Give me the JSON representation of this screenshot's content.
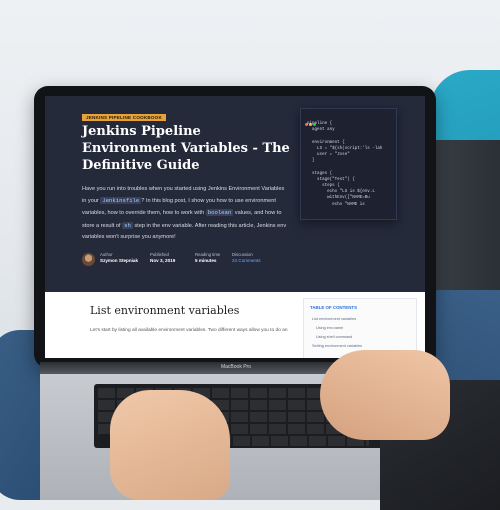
{
  "article": {
    "tag": "JENKINS PIPELINE COOKBOOK",
    "title": "Jenkins Pipeline Environment Variables - The Definitive Guide",
    "intro_parts": [
      "Have you run into troubles when you started using Jenkins Environment Variables in your ",
      "Jenkinsfile",
      "? In this blog post, I show you how to use environment variables, how to override them, how to work with ",
      "boolean",
      " values, and how to store a result of ",
      "sh",
      " step in the env variable. After reading this article, Jenkins env variables won't surprise you anymore!"
    ],
    "author_label": "Author",
    "author_name": "Szymon Stepniak",
    "published_label": "Published",
    "published_value": "Nov 3, 2019",
    "reading_label": "Reading time",
    "reading_value": "5 minutes",
    "discuss_label": "Discussion",
    "discuss_value": "24 Comments"
  },
  "code_snippet": [
    {
      "t": "pipeline {"
    },
    {
      "t": "  agent any"
    },
    {
      "t": ""
    },
    {
      "t": "  environment {"
    },
    {
      "t": "    LS = \"${sh(script:'ls -lah"
    },
    {
      "t": "    user = \"Jose\""
    },
    {
      "t": "  }"
    },
    {
      "t": ""
    },
    {
      "t": "  stages {"
    },
    {
      "t": "    stage(\"Test\") {"
    },
    {
      "t": "      steps {"
    },
    {
      "t": "        echo \"LS is ${env.L"
    },
    {
      "t": "        withEnv([\"NAME=Bu"
    },
    {
      "t": "          echo \"NAME is"
    }
  ],
  "content": {
    "heading": "List environment variables",
    "paragraph": "Let's start by listing all available environment variables. Two different ways allow you to do an"
  },
  "toc": {
    "title": "TABLE OF CONTENTS",
    "items": [
      "List environment variables",
      "Using env.name",
      "Using shell command",
      "Setting environment variables"
    ]
  },
  "device": {
    "brand": "MacBook Pro"
  },
  "colors": {
    "hero_bg": "#242a3a",
    "tag_bg": "#e7a23a",
    "link": "#6aa8ff",
    "window_dot_red": "#ff5f56",
    "window_dot_yellow": "#ffbd2e",
    "window_dot_green": "#27c93f"
  }
}
